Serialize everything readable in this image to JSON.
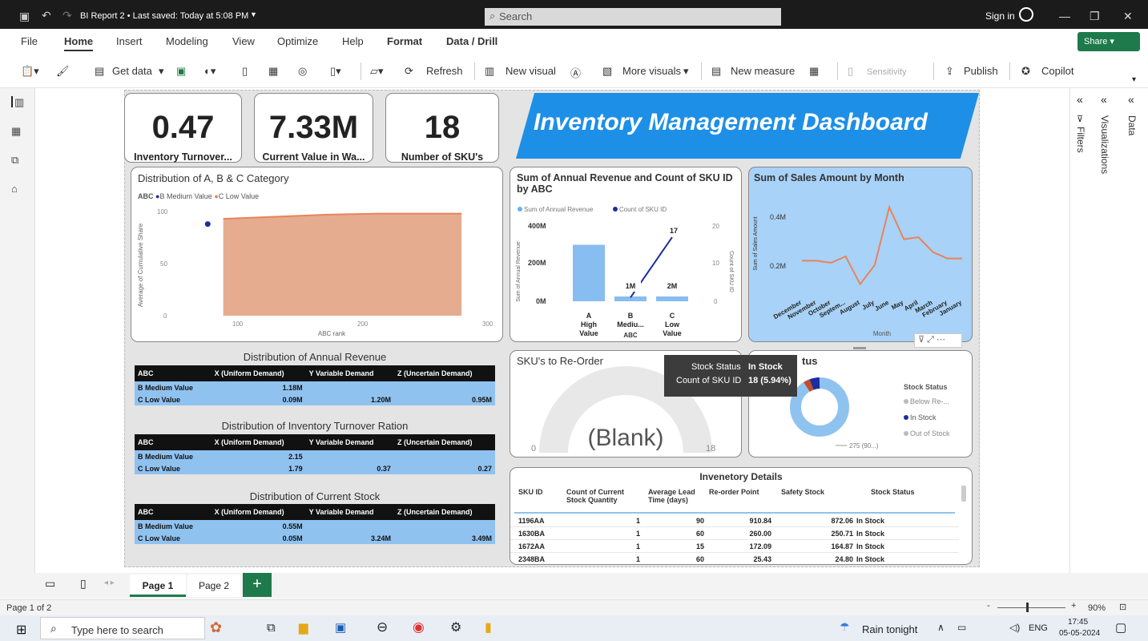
{
  "titlebar": {
    "title": "BI Report 2 • Last saved: Today at 5:08 PM",
    "search": "Search",
    "signin": "Sign in"
  },
  "menu": [
    "File",
    "Home",
    "Insert",
    "Modeling",
    "View",
    "Optimize",
    "Help",
    "Format",
    "Data / Drill"
  ],
  "share": "Share",
  "ribbon": {
    "get_data": "Get data",
    "refresh": "Refresh",
    "new_visual": "New visual",
    "more_visuals": "More visuals",
    "new_measure": "New measure",
    "sensitivity": "Sensitivity",
    "publish": "Publish",
    "copilot": "Copilot"
  },
  "kpis": [
    {
      "value": "0.47",
      "label": "Inventory Turnover..."
    },
    {
      "value": "7.33M",
      "label": "Current Value in Wa..."
    },
    {
      "value": "18",
      "label": "Number of SKU's"
    }
  ],
  "banner": "Inventory Management Dashboard",
  "abc_chart": {
    "title": "Distribution of A, B & C Category",
    "legend_title": "ABC",
    "legend": [
      "B Medium Value",
      "C Low Value"
    ],
    "ylabel": "Average of Cumulative Share",
    "xlabel": "ABC rank",
    "yticks": [
      "100",
      "50",
      "0"
    ],
    "xticks": [
      "100",
      "200",
      "300"
    ]
  },
  "matrix1": {
    "title": "Distribution of Annual Revenue",
    "headers": [
      "ABC",
      "X (Uniform Demand)",
      "Y Variable Demand",
      "Z (Uncertain Demand)"
    ],
    "rows": [
      [
        "B Medium Value",
        "1.18M",
        "",
        ""
      ],
      [
        "C Low Value",
        "0.09M",
        "1.20M",
        "0.95M"
      ]
    ]
  },
  "matrix2": {
    "title": "Distribution of Inventory Turnover Ration",
    "headers": [
      "ABC",
      "X (Uniform Demand)",
      "Y Variable Demand",
      "Z (Uncertain Demand)"
    ],
    "rows": [
      [
        "B Medium Value",
        "2.15",
        "",
        ""
      ],
      [
        "C Low Value",
        "1.79",
        "0.37",
        "0.27"
      ]
    ]
  },
  "matrix3": {
    "title": "Distribution of Current Stock",
    "headers": [
      "ABC",
      "X (Uniform Demand)",
      "Y Variable Demand",
      "Z (Uncertain Demand)"
    ],
    "rows": [
      [
        "B Medium Value",
        "0.55M",
        "",
        ""
      ],
      [
        "C Low Value",
        "0.05M",
        "3.24M",
        "3.49M"
      ]
    ]
  },
  "combo_chart": {
    "title": "Sum of Annual Revenue and Count of SKU ID by ABC",
    "legend": [
      "Sum of Annual Revenue",
      "Count of SKU ID"
    ],
    "yleft": [
      "400M",
      "200M",
      "0M"
    ],
    "yright": [
      "20",
      "10",
      "0"
    ],
    "yleft_label": "Sum of Annual Revenue",
    "yright_label": "Count of SKU ID",
    "xlabel": "ABC",
    "categories": [
      "A High Value",
      "B Mediu...",
      "C Low Value"
    ],
    "data_labels": [
      "1M",
      "2M",
      "17"
    ]
  },
  "month_chart": {
    "title": "Sum of Sales Amount by Month",
    "ylabel": "Sum of Sales Amount",
    "xlabel": "Month",
    "yticks": [
      "0.4M",
      "0.2M"
    ],
    "months": [
      "December",
      "November",
      "October",
      "Septem...",
      "August",
      "July",
      "June",
      "May",
      "April",
      "March",
      "February",
      "January"
    ]
  },
  "gauge": {
    "title": "SKU's to Re-Order",
    "value": "(Blank)",
    "min": "0",
    "max": "18"
  },
  "donut": {
    "title_visible": "tus",
    "legend_title": "Stock Status",
    "legend": [
      "Below Re-...",
      "In Stock",
      "Out of Stock"
    ],
    "label": "275 (90...)"
  },
  "tooltip": {
    "k1": "Stock Status",
    "v1": "In Stock",
    "k2": "Count of SKU ID",
    "v2": "18 (5.94%)"
  },
  "details": {
    "title": "Invenetory Details",
    "headers": [
      "SKU ID",
      "Count of Current Stock Quantity",
      "Average Lead Time (days)",
      "Re-order Point",
      "Safety Stock",
      "Stock Status"
    ],
    "rows": [
      [
        "1196AA",
        "1",
        "90",
        "910.84",
        "872.06",
        "In Stock"
      ],
      [
        "1630BA",
        "1",
        "60",
        "260.00",
        "250.71",
        "In Stock"
      ],
      [
        "1672AA",
        "1",
        "15",
        "172.09",
        "164.87",
        "In Stock"
      ],
      [
        "2348BA",
        "1",
        "60",
        "25.43",
        "24.80",
        "In Stock"
      ]
    ]
  },
  "panes": [
    "Filters",
    "Visualizations",
    "Data"
  ],
  "pages": [
    "Page 1",
    "Page 2"
  ],
  "status": {
    "page": "Page 1 of 2",
    "zoom": "90%"
  },
  "taskbar": {
    "search": "Type here to search",
    "weather": "Rain tonight",
    "lang": "ENG",
    "time": "17:45",
    "date": "05-05-2024"
  },
  "chart_data": [
    {
      "type": "area",
      "title": "Distribution of A, B & C Category",
      "series": [
        {
          "name": "C Low Value",
          "x": [
            50,
            100,
            150,
            200,
            250,
            280
          ],
          "y": [
            93,
            95,
            97,
            98,
            98,
            98
          ]
        },
        {
          "name": "B Medium Value",
          "x": [
            35
          ],
          "y": [
            88
          ]
        }
      ],
      "xlim": [
        0,
        300
      ],
      "ylim": [
        0,
        100
      ]
    },
    {
      "type": "bar",
      "title": "Sum of Annual Revenue and Count of SKU ID by ABC",
      "categories": [
        "A High Value",
        "B Mediu...",
        "C Low Value"
      ],
      "series": [
        {
          "name": "Sum of Annual Revenue",
          "values": [
            300,
            1,
            2
          ]
        },
        {
          "name": "Count of SKU ID",
          "values": [
            0,
            1,
            17
          ]
        }
      ]
    },
    {
      "type": "line",
      "title": "Sum of Sales Amount by Month",
      "categories": [
        "December",
        "November",
        "October",
        "Septem...",
        "August",
        "July",
        "June",
        "May",
        "April",
        "March",
        "February",
        "January"
      ],
      "values": [
        0.25,
        0.25,
        0.24,
        0.27,
        0.14,
        0.23,
        0.5,
        0.35,
        0.36,
        0.29,
        0.26,
        0.26
      ]
    }
  ]
}
